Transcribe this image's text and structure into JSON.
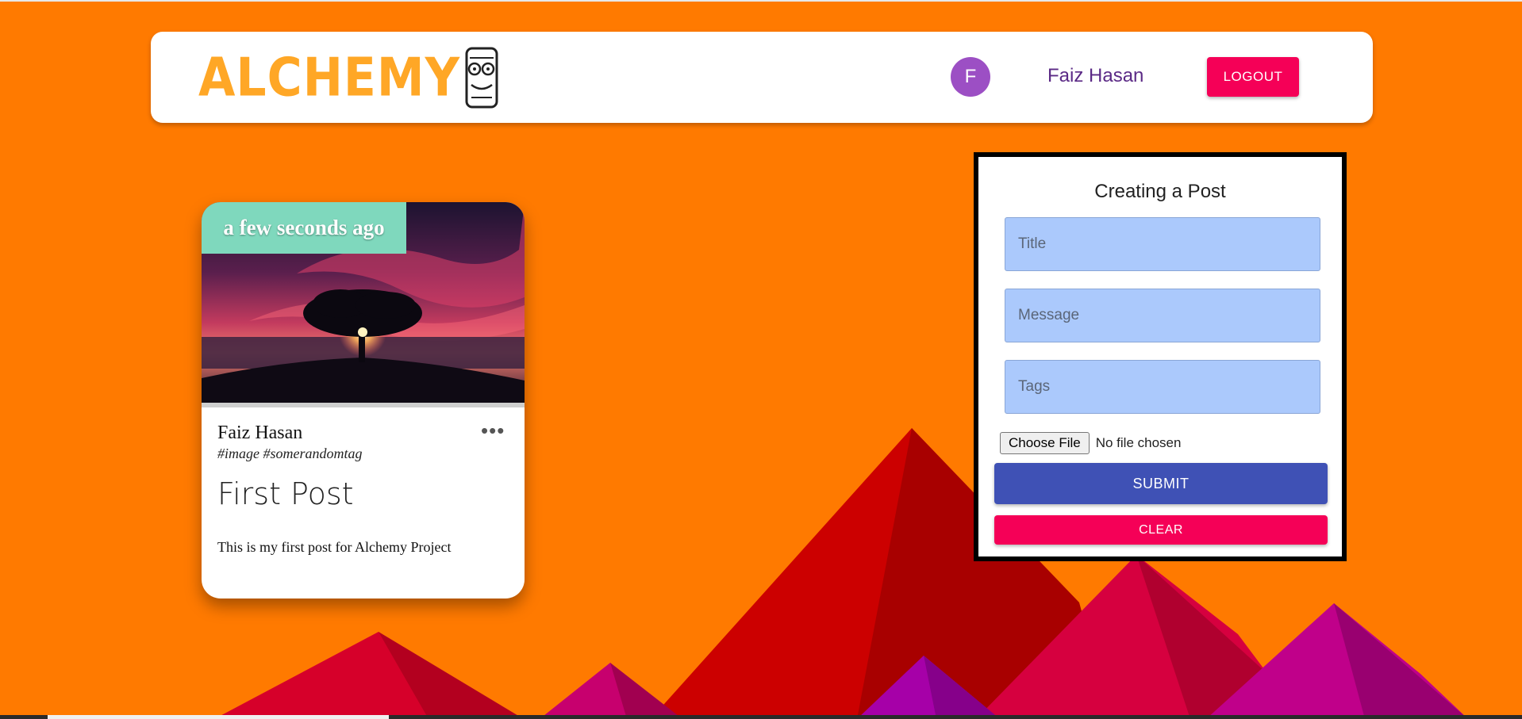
{
  "header": {
    "brand": "ALCHEMY",
    "avatar_initial": "F",
    "user_name": "Faiz Hasan",
    "logout_label": "LOGOUT"
  },
  "post": {
    "time": "a few seconds ago",
    "author": "Faiz Hasan",
    "tags": "#image #somerandomtag",
    "title": "First Post",
    "message": "This is my first post for Alchemy Project",
    "more_icon": "more-horizontal-icon"
  },
  "form": {
    "title": "Creating a Post",
    "title_placeholder": "Title",
    "message_placeholder": "Message",
    "tags_placeholder": "Tags",
    "file_button": "Choose File",
    "file_status": "No file chosen",
    "submit_label": "SUBMIT",
    "clear_label": "CLEAR"
  },
  "colors": {
    "background": "#ff7a00",
    "brand": "#ffa726",
    "primary": "#3f51b5",
    "secondary": "#f50057",
    "avatar": "#9c4fc4",
    "time_badge": "#7fd8bd",
    "field": "#abc9fc"
  }
}
